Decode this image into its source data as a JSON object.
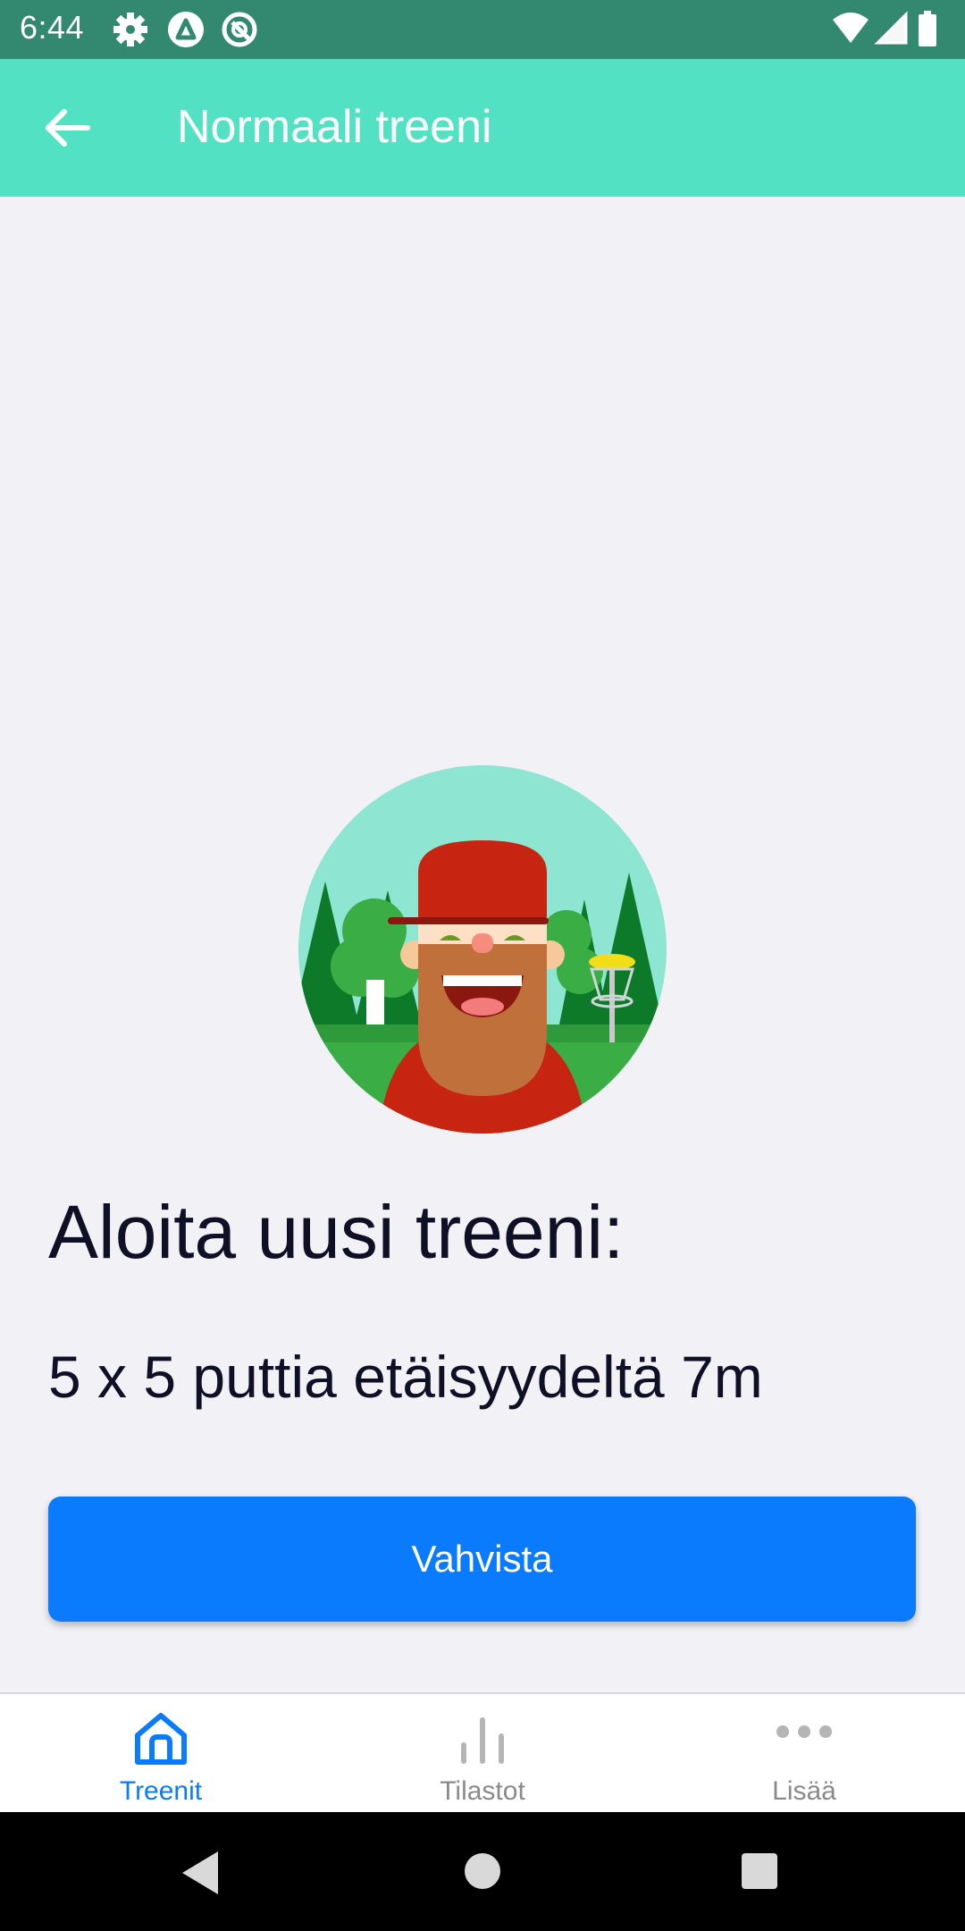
{
  "status_bar": {
    "time": "6:44",
    "left_icons": [
      "gear-icon",
      "app-a-icon",
      "at-icon"
    ],
    "right_icons": [
      "wifi-icon",
      "signal-icon",
      "battery-icon"
    ]
  },
  "app_bar": {
    "title": "Normaali treeni",
    "back_icon": "arrow-left-icon"
  },
  "main": {
    "headline": "Aloita uusi treeni:",
    "subtitle": "5 x 5 puttia etäisyydeltä 7m",
    "confirm_label": "Vahvista"
  },
  "bottom_nav": {
    "items": [
      {
        "label": "Treenit",
        "icon": "home-icon",
        "active": true
      },
      {
        "label": "Tilastot",
        "icon": "stats-icon",
        "active": false
      },
      {
        "label": "Lisää",
        "icon": "more-icon",
        "active": false
      }
    ]
  },
  "system_nav": [
    "back-triangle-icon",
    "home-circle-icon",
    "recents-square-icon"
  ],
  "colors": {
    "status_bar": "#33896f",
    "app_bar": "#52e2c3",
    "background": "#f2f1f6",
    "accent": "#0b7bfe",
    "text_dark": "#0f1026",
    "nav_inactive": "#8a8a8a"
  }
}
